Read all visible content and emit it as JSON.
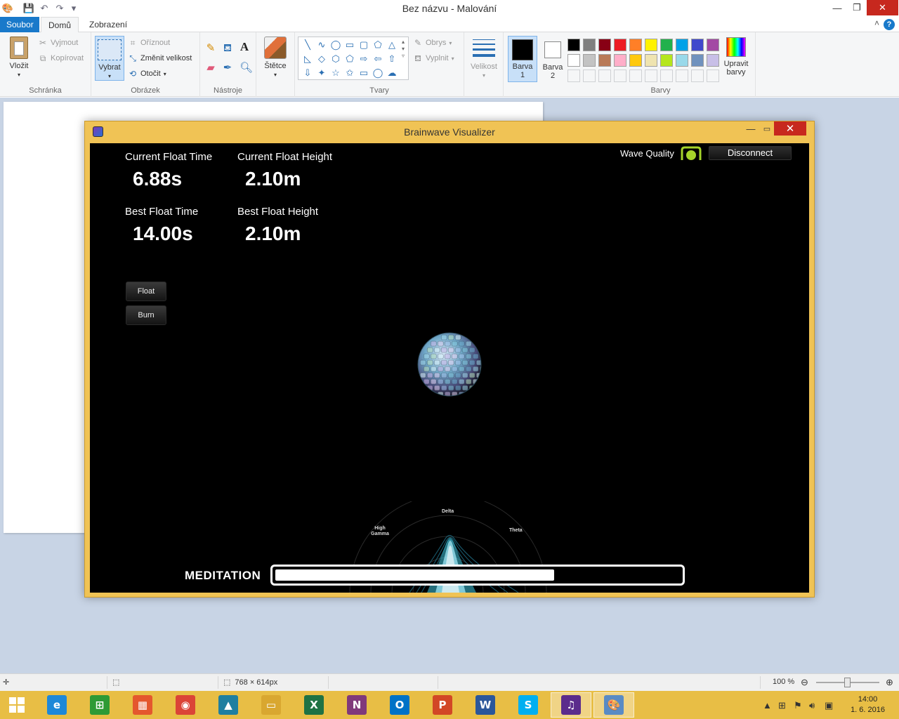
{
  "paint": {
    "title": "Bez názvu - Malování",
    "tabs": {
      "file": "Soubor",
      "home": "Domů",
      "view": "Zobrazení"
    },
    "clipboard": {
      "paste": "Vložit",
      "cut": "Vyjmout",
      "copy": "Kopírovat",
      "group": "Schránka"
    },
    "image": {
      "select": "Vybrat",
      "crop": "Oříznout",
      "resize": "Změnit velikost",
      "rotate": "Otočit",
      "group": "Obrázek"
    },
    "tools": {
      "group": "Nástroje"
    },
    "brushes": {
      "label": "Štětce"
    },
    "shapes": {
      "outline": "Obrys",
      "fill": "Vyplnit",
      "group": "Tvary",
      "glyphs": [
        "╲",
        "∿",
        "◯",
        "▭",
        "▢",
        "⬠",
        "△",
        "◺",
        "◇",
        "⬡",
        "⬠",
        "⇨",
        "⇦",
        "⇧",
        "⇩",
        "✦",
        "☆",
        "✩",
        "▭",
        "◯",
        "☁"
      ]
    },
    "size": {
      "label": "Velikost"
    },
    "color1": {
      "label1": "Barva",
      "label2": "1",
      "value": "#000000"
    },
    "color2": {
      "label1": "Barva",
      "label2": "2",
      "value": "#ffffff"
    },
    "colors": {
      "group": "Barvy",
      "edit1": "Upravit",
      "edit2": "barvy",
      "row1": [
        "#000000",
        "#7f7f7f",
        "#880015",
        "#ed1c24",
        "#ff7f27",
        "#fff200",
        "#22b14c",
        "#00a2e8",
        "#3f48cc",
        "#a349a4"
      ],
      "row2": [
        "#ffffff",
        "#c3c3c3",
        "#b97a57",
        "#ffaec9",
        "#ffc90e",
        "#efe4b0",
        "#b5e61d",
        "#99d9ea",
        "#7092be",
        "#c8bfe7"
      ]
    },
    "status": {
      "canvas_size": "768 × 614px",
      "zoom": "100 %"
    }
  },
  "brainwave": {
    "title": "Brainwave Visualizer",
    "current_float_time_label": "Current Float Time",
    "current_float_time": "6.88s",
    "current_float_height_label": "Current Float Height",
    "current_float_height": "2.10m",
    "best_float_time_label": "Best Float Time",
    "best_float_time": "14.00s",
    "best_float_height_label": "Best Float Height",
    "best_float_height": "2.10m",
    "float_button": "Float",
    "burn_button": "Burn",
    "wave_quality_label": "Wave Quality",
    "wave_quality_color": "#a5d42a",
    "disconnect_button": "Disconnect",
    "radar_labels": {
      "delta": "Delta",
      "theta": "Theta",
      "high_gamma_1": "High",
      "high_gamma_2": "Gamma"
    },
    "meditation_label": "MEDITATION",
    "meditation_level": 0.69
  },
  "taskbar": {
    "apps": [
      {
        "name": "explorer-ie",
        "glyph": "e",
        "color": "#1e88d8"
      },
      {
        "name": "store",
        "glyph": "⊞",
        "color": "#2e9a35"
      },
      {
        "name": "photo-gallery",
        "glyph": "▦",
        "color": "#e4572e"
      },
      {
        "name": "chrome",
        "glyph": "◉",
        "color": "#db4437"
      },
      {
        "name": "photos",
        "glyph": "▲",
        "color": "#1f7fa0"
      },
      {
        "name": "file-explorer",
        "glyph": "▭",
        "color": "#d9a730"
      },
      {
        "name": "excel",
        "glyph": "X",
        "color": "#1f7244"
      },
      {
        "name": "onenote",
        "glyph": "N",
        "color": "#80397b"
      },
      {
        "name": "outlook",
        "glyph": "O",
        "color": "#0072c6"
      },
      {
        "name": "powerpoint",
        "glyph": "P",
        "color": "#d24726"
      },
      {
        "name": "word",
        "glyph": "W",
        "color": "#2b579a"
      },
      {
        "name": "skype",
        "glyph": "S",
        "color": "#00aff0"
      },
      {
        "name": "brainwave-visualizer",
        "glyph": "♫",
        "color": "#5b2c8c"
      },
      {
        "name": "paint",
        "glyph": "🎨",
        "color": "#5a8bc4"
      }
    ],
    "time": "14:00",
    "date": "1. 6. 2016"
  }
}
